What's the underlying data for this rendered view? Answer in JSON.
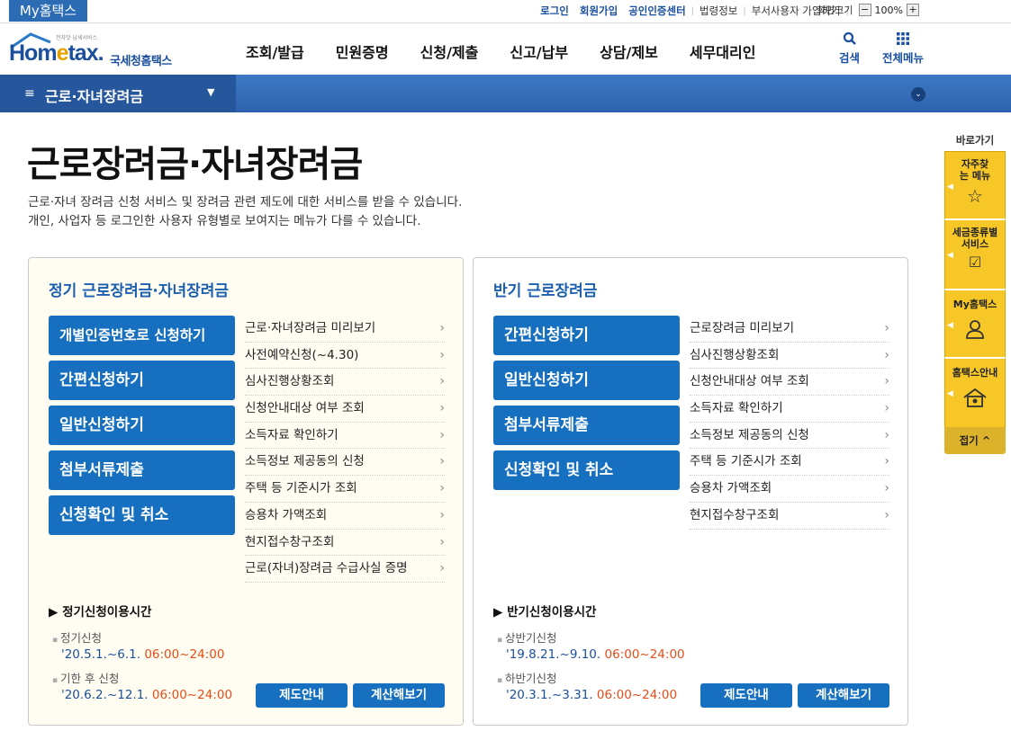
{
  "top": {
    "my_hometax": "My홈택스",
    "links": [
      "로그인",
      "회원가입",
      "공인인증센터",
      "법령정보",
      "부서사용자 가입하기"
    ],
    "zoom_label": "화면크기",
    "zoom_value": "100%",
    "zoom_minus": "−",
    "zoom_plus": "+"
  },
  "header": {
    "logo_main_pre": "Hom",
    "logo_main_accent": "e",
    "logo_main_post": "tax.",
    "logo_sub": "국세청홈택스",
    "logo_tiny": "전자맛 납세서비스",
    "gnb": [
      "조회/발급",
      "민원증명",
      "신청/제출",
      "신고/납부",
      "상담/제보",
      "세무대리인"
    ],
    "search_label": "검색",
    "allmenu_label": "전체메뉴"
  },
  "nav": {
    "menu_icon": "≡",
    "current": "근로·자녀장려금"
  },
  "page": {
    "title": "근로장려금·자녀장려금",
    "desc1": "근로·자녀 장려금 신청 서비스 및 장려금 관련 제도에 대한 서비스를 받을 수 있습니다.",
    "desc2": "개인, 사업자 등 로그인한 사용자 유형별로 보여지는 메뉴가 다를 수 있습니다."
  },
  "panel1": {
    "title": "정기 근로장려금·자녀장려금",
    "buttons": [
      "개별인증번호로 신청하기",
      "간편신청하기",
      "일반신청하기",
      "첨부서류제출",
      "신청확인 및 취소"
    ],
    "links": [
      "근로·자녀장려금 미리보기",
      "사전예약신청(~4.30)",
      "심사진행상황조회",
      "신청안내대상 여부 조회",
      "소득자료 확인하기",
      "소득정보 제공동의 신청",
      "주택 등 기준시가 조회",
      "승용차 가액조회",
      "현지접수창구조회",
      "근로(자녀)장려금 수급사실 증명"
    ],
    "time_title": "정기신청이용시간",
    "t1_label": "정기신청",
    "t1_date": "'20.5.1.~6.1.",
    "t1_time": "06:00~24:00",
    "t2_label": "기한 후 신청",
    "t2_date": "'20.6.2.~12.1.",
    "t2_time": "06:00~24:00",
    "btn_guide": "제도안내",
    "btn_calc": "계산해보기"
  },
  "panel2": {
    "title": "반기 근로장려금",
    "buttons": [
      "간편신청하기",
      "일반신청하기",
      "첨부서류제출",
      "신청확인 및 취소"
    ],
    "links": [
      "근로장려금 미리보기",
      "심사진행상황조회",
      "신청안내대상 여부 조회",
      "소득자료 확인하기",
      "소득정보 제공동의 신청",
      "주택 등 기준시가 조회",
      "승용차 가액조회",
      "현지접수창구조회"
    ],
    "time_title": "반기신청이용시간",
    "t1_label": "상반기신청",
    "t1_date": "'19.8.21.~9.10.",
    "t1_time": "06:00~24:00",
    "t2_label": "하반기신청",
    "t2_date": "'20.3.1.~3.31.",
    "t2_time": "06:00~24:00",
    "btn_guide": "제도안내",
    "btn_calc": "계산해보기"
  },
  "quick": {
    "title": "바로가기",
    "items": [
      "자주찾는 메뉴",
      "세금종류별 서비스",
      "My홈택스",
      "홈택스안내"
    ],
    "fold": "접기 ^"
  },
  "colors": {
    "brand_blue": "#1670bf",
    "nav_blue": "#2d63ae",
    "accent_red": "#e74c17",
    "quick_yellow": "#f6c727"
  }
}
